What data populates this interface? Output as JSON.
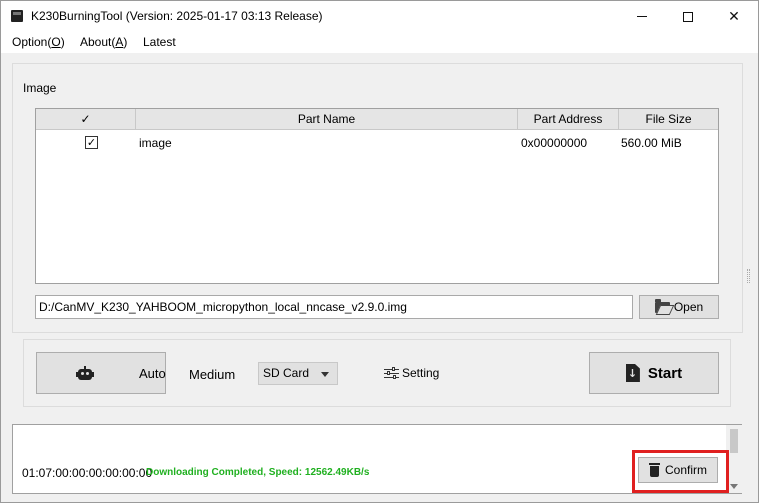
{
  "window": {
    "title": "K230BurningTool (Version: 2025-01-17 03:13 Release)",
    "controls": [
      "minimize",
      "maximize",
      "close"
    ]
  },
  "menu": {
    "items": [
      {
        "label": "Option(O)",
        "underline": "O"
      },
      {
        "label": "About(A)",
        "underline": "A"
      },
      {
        "label": "Latest"
      }
    ]
  },
  "image_group": {
    "label": "Image",
    "table": {
      "header_check": "✓",
      "columns": [
        "Part Name",
        "Part Address",
        "File Size"
      ],
      "rows": [
        {
          "checked": true,
          "check_glyph": "✓",
          "name": "image",
          "address": "0x00000000",
          "size": "560.00 MiB"
        }
      ]
    },
    "path": "D:/CanMV_K230_YAHBOOM_micropython_local_nncase_v2.9.0.img",
    "open_label": "Open"
  },
  "controls": {
    "auto_label": "Auto",
    "medium_label": "Medium",
    "medium_value": "SD Card",
    "setting_label": "Setting",
    "start_label": "Start"
  },
  "log": {
    "time": "01:07:00:00:00:00:00:00",
    "status": "Downloading Completed, Speed: 12562.49KB/s",
    "status_color": "#20b020",
    "confirm_label": "Confirm"
  },
  "highlight_color": "#e02020"
}
